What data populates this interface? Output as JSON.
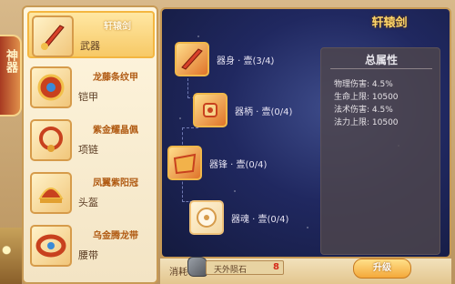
{
  "side_tab": {
    "label": "神器"
  },
  "equipment_list": [
    {
      "name": "轩辕剑",
      "type": "武器",
      "icon": "sword-icon",
      "selected": true
    },
    {
      "name": "龙藤条纹甲",
      "type": "铠甲",
      "icon": "armor-icon",
      "selected": false
    },
    {
      "name": "紫金耀晶佩",
      "type": "项链",
      "icon": "necklace-icon",
      "selected": false
    },
    {
      "name": "凤翼紫阳冠",
      "type": "头盔",
      "icon": "helmet-icon",
      "selected": false
    },
    {
      "name": "乌金腾龙带",
      "type": "腰带",
      "icon": "belt-icon",
      "selected": false
    }
  ],
  "weapon": {
    "title": "轩辕剑",
    "parts": [
      {
        "label": "器身 · 壹(3/4)",
        "icon": "blade-icon"
      },
      {
        "label": "器柄 · 壹(0/4)",
        "icon": "hilt-icon"
      },
      {
        "label": "器锋 · 壹(0/4)",
        "icon": "edge-icon"
      },
      {
        "label": "器魂 · 壹(0/4)",
        "icon": "soul-icon"
      }
    ]
  },
  "stats": {
    "title": "总属性",
    "lines": [
      {
        "text": "物理伤害: 4.5%"
      },
      {
        "text": "生命上限: 10500"
      },
      {
        "text": "法术伤害: 4.5%"
      },
      {
        "text": "法力上限: 10500"
      }
    ]
  },
  "cost": {
    "label": "消耗",
    "item_name": "天外陨石",
    "item_count": "8",
    "item_icon": "meteorite-stone-icon"
  },
  "upgrade_button": {
    "label": "升级"
  },
  "colors": {
    "accent_gold": "#ffd66a",
    "selected_bg": "#f7c966",
    "cost_red": "#d42a1a"
  }
}
